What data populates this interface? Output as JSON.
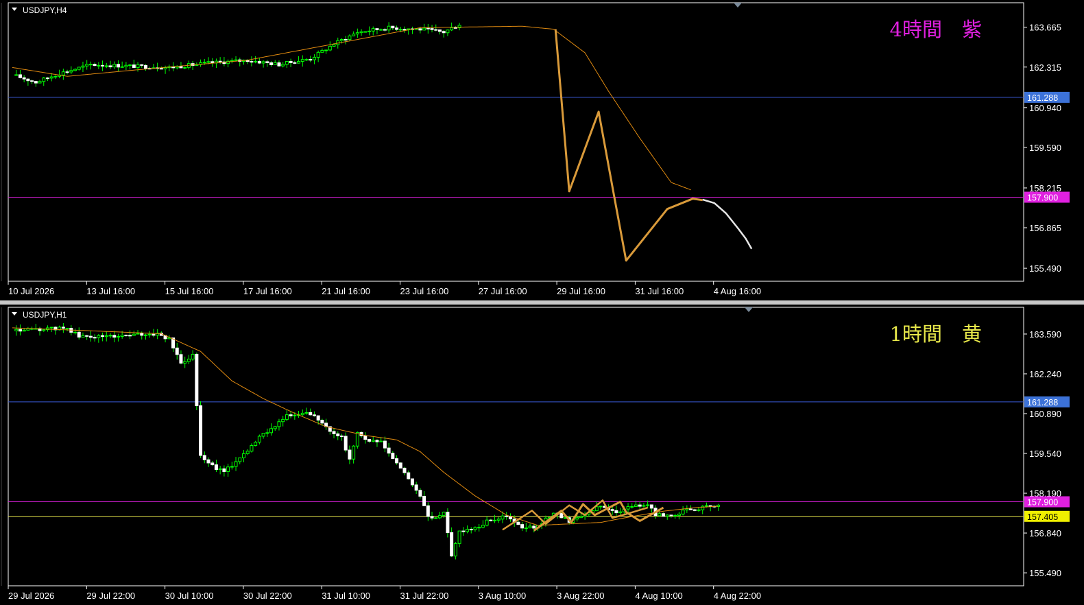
{
  "colors": {
    "background": "#000000",
    "frame": "#ffffff",
    "bull": "#ffffff",
    "bear": "#ffffff",
    "wick": "#00ff00",
    "ma": "#e08a10",
    "zigzag": "#d99a3a",
    "projection": "#e6e6e6",
    "level_blue": "#3a5bd8",
    "level_magenta": "#e020e0",
    "level_yellow": "#e8e84a",
    "label_blue_bg": "#3c72d8",
    "label_magenta_bg": "#e020e0",
    "label_yellow_bg": "#f0f000"
  },
  "panes": [
    {
      "id": "h4",
      "symbol": "USDJPY,H4",
      "note": "4時間　紫",
      "note_color": "#e020e0",
      "price_axis": [
        "163.665",
        "162.315",
        "160.940",
        "159.590",
        "158.215",
        "156.865",
        "155.490"
      ],
      "price_axis_values": [
        163.665,
        162.315,
        160.94,
        159.59,
        158.215,
        156.865,
        155.49
      ],
      "time_axis": [
        "10 Jul 2026",
        "13 Jul 16:00",
        "15 Jul 16:00",
        "17 Jul 16:00",
        "21 Jul 16:00",
        "23 Jul 16:00",
        "27 Jul 16:00",
        "29 Jul 16:00",
        "31 Jul 16:00",
        "4 Aug 16:00"
      ],
      "ylim": [
        155.05,
        164.45
      ],
      "levels": [
        {
          "price": 161.288,
          "label": "161.288",
          "kind": "blue"
        },
        {
          "price": 157.9,
          "label": "157.900",
          "kind": "magenta"
        }
      ],
      "candles": {
        "count": 114,
        "start": 162.05,
        "path": [
          [
            0,
            162.05
          ],
          [
            6,
            161.8
          ],
          [
            12,
            162.1
          ],
          [
            20,
            162.4
          ],
          [
            30,
            162.35
          ],
          [
            40,
            162.3
          ],
          [
            50,
            162.45
          ],
          [
            60,
            162.55
          ],
          [
            68,
            162.4
          ],
          [
            76,
            162.6
          ],
          [
            82,
            163.1
          ],
          [
            88,
            163.5
          ],
          [
            96,
            163.65
          ],
          [
            104,
            163.6
          ],
          [
            110,
            163.5
          ],
          [
            116,
            163.9
          ],
          [
            124,
            163.7
          ],
          [
            130,
            163.9
          ],
          [
            134,
            163.7
          ],
          [
            138,
            163.3
          ],
          [
            141,
            159.8
          ],
          [
            143,
            158.0
          ],
          [
            147,
            160.8
          ],
          [
            149,
            160.4
          ],
          [
            151,
            158.8
          ],
          [
            154,
            160.7
          ],
          [
            156,
            158.9
          ],
          [
            158,
            157.6
          ],
          [
            160,
            156.9
          ],
          [
            162,
            156.2
          ],
          [
            164,
            155.7
          ],
          [
            168,
            156.5
          ],
          [
            172,
            157.2
          ],
          [
            176,
            157.6
          ],
          [
            180,
            157.9
          ],
          [
            184,
            157.8
          ],
          [
            190,
            157.95
          ]
        ]
      },
      "ma_path": [
        [
          0,
          162.3
        ],
        [
          14,
          162.0
        ],
        [
          30,
          162.2
        ],
        [
          60,
          162.55
        ],
        [
          80,
          163.05
        ],
        [
          104,
          163.65
        ],
        [
          130,
          163.7
        ],
        [
          138,
          163.6
        ],
        [
          146,
          162.8
        ],
        [
          152,
          161.5
        ],
        [
          160,
          159.9
        ],
        [
          168,
          158.4
        ],
        [
          173,
          158.15
        ]
      ],
      "zigzag": [
        [
          138.5,
          163.6
        ],
        [
          142,
          158.1
        ],
        [
          149.5,
          160.8
        ],
        [
          153.5,
          157.9
        ],
        [
          156.5,
          155.75
        ],
        [
          167,
          157.5
        ],
        [
          173.5,
          157.85
        ],
        [
          176,
          157.8
        ]
      ],
      "projection": [
        [
          176,
          157.82
        ],
        [
          179,
          157.7
        ],
        [
          182,
          157.35
        ],
        [
          185,
          156.85
        ],
        [
          187,
          156.5
        ],
        [
          188.5,
          156.15
        ]
      ]
    },
    {
      "id": "h1",
      "symbol": "USDJPY,H1",
      "note": "1時間　黄",
      "note_color": "#e8e84a",
      "price_axis": [
        "163.590",
        "162.240",
        "160.890",
        "159.540",
        "158.190",
        "156.840",
        "155.490"
      ],
      "price_axis_values": [
        163.59,
        162.24,
        160.89,
        159.54,
        158.19,
        156.84,
        155.49
      ],
      "time_axis": [
        "29 Jul 2026",
        "29 Jul 22:00",
        "30 Jul 10:00",
        "30 Jul 22:00",
        "31 Jul 10:00",
        "31 Jul 22:00",
        "3 Aug 10:00",
        "3 Aug 22:00",
        "4 Aug 10:00",
        "4 Aug 22:00"
      ],
      "ylim": [
        155.05,
        164.45
      ],
      "levels": [
        {
          "price": 161.288,
          "label": "161.288",
          "kind": "blue"
        },
        {
          "price": 157.9,
          "label": "157.900",
          "kind": "magenta"
        },
        {
          "price": 157.405,
          "label": "157.405",
          "kind": "yellow"
        }
      ],
      "candles": {
        "count": 180,
        "start": 163.7,
        "path": [
          [
            0,
            163.7
          ],
          [
            8,
            163.75
          ],
          [
            14,
            163.8
          ],
          [
            17,
            163.5
          ],
          [
            22,
            163.5
          ],
          [
            30,
            163.55
          ],
          [
            37,
            163.6
          ],
          [
            40,
            163.4
          ],
          [
            43,
            162.6
          ],
          [
            46,
            162.9
          ],
          [
            48,
            159.5
          ],
          [
            50,
            159.2
          ],
          [
            54,
            158.9
          ],
          [
            58,
            159.4
          ],
          [
            64,
            160.2
          ],
          [
            70,
            160.8
          ],
          [
            76,
            160.9
          ],
          [
            80,
            160.4
          ],
          [
            84,
            160.1
          ],
          [
            86,
            159.3
          ],
          [
            88,
            160.3
          ],
          [
            90,
            160.0
          ],
          [
            94,
            159.9
          ],
          [
            98,
            159.2
          ],
          [
            102,
            158.5
          ],
          [
            104,
            158.1
          ],
          [
            106,
            157.4
          ],
          [
            108,
            157.3
          ],
          [
            110,
            157.6
          ],
          [
            112,
            156.1
          ],
          [
            114,
            156.9
          ],
          [
            118,
            157.0
          ],
          [
            122,
            157.3
          ],
          [
            126,
            157.4
          ],
          [
            130,
            157.0
          ],
          [
            134,
            157.05
          ],
          [
            138,
            157.55
          ],
          [
            142,
            157.25
          ],
          [
            146,
            157.5
          ],
          [
            150,
            157.75
          ],
          [
            154,
            157.55
          ],
          [
            158,
            157.75
          ],
          [
            162,
            157.8
          ],
          [
            164,
            157.45
          ],
          [
            168,
            157.45
          ],
          [
            172,
            157.6
          ],
          [
            176,
            157.7
          ],
          [
            180,
            157.75
          ]
        ]
      },
      "ma_path": [
        [
          0,
          163.8
        ],
        [
          20,
          163.7
        ],
        [
          38,
          163.6
        ],
        [
          48,
          163.0
        ],
        [
          56,
          162.0
        ],
        [
          64,
          161.4
        ],
        [
          72,
          160.9
        ],
        [
          80,
          160.45
        ],
        [
          90,
          160.15
        ],
        [
          98,
          160.0
        ],
        [
          104,
          159.6
        ],
        [
          110,
          158.9
        ],
        [
          118,
          158.1
        ],
        [
          126,
          157.45
        ],
        [
          134,
          157.1
        ],
        [
          142,
          157.15
        ],
        [
          150,
          157.2
        ],
        [
          158,
          157.4
        ],
        [
          166,
          157.58
        ],
        [
          174,
          157.7
        ],
        [
          180,
          157.75
        ]
      ],
      "zigzag": [
        [
          133,
          156.92
        ],
        [
          140,
          157.6
        ],
        [
          142.5,
          157.2
        ],
        [
          145.5,
          157.82
        ],
        [
          148.5,
          157.45
        ],
        [
          155,
          157.9
        ],
        [
          156.5,
          157.55
        ],
        [
          160,
          157.25
        ],
        [
          166,
          157.7
        ]
      ],
      "zigzag2": [
        [
          125,
          156.95
        ],
        [
          132.5,
          157.6
        ],
        [
          136,
          157.15
        ],
        [
          142,
          157.78
        ],
        [
          146,
          157.45
        ],
        [
          150.5,
          157.95
        ],
        [
          153,
          157.35
        ],
        [
          157,
          157.5
        ],
        [
          162,
          157.7
        ]
      ]
    }
  ]
}
